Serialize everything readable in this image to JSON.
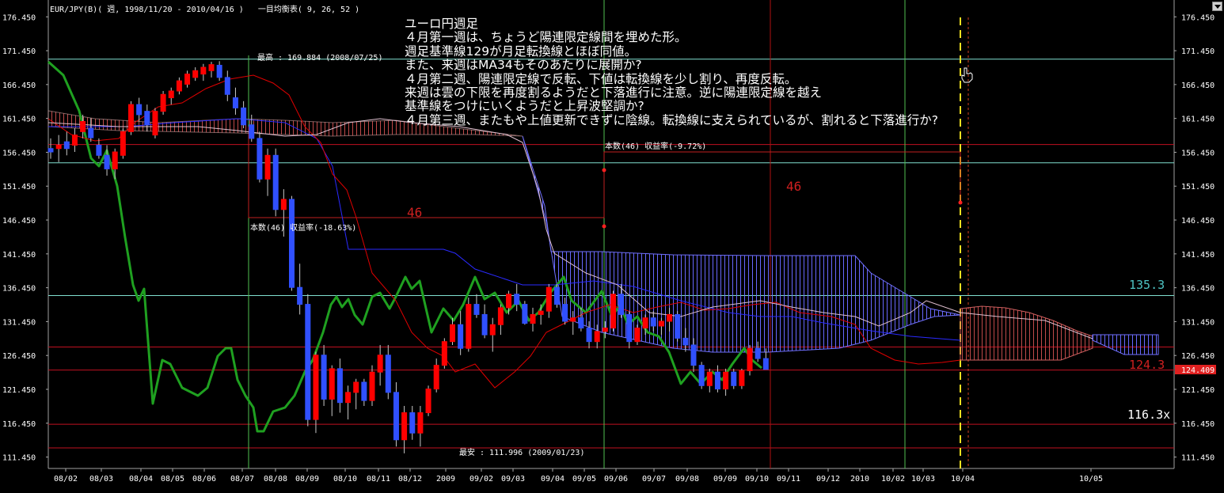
{
  "header": {
    "symbol": "EUR/JPY(B)( 週, 1998/11/20 - 2010/04/16 )",
    "indicator": "一目均衡表( 9, 26, 52 )"
  },
  "notes": [
    "ユーロ円週足",
    "４月第一週は、ちょうど陽連限定線間を埋めた形。",
    "週足基準線129が月足転換線とほぼ同値。",
    "また、来週はMA34もそのあたりに展開か?",
    "４月第二週、陽連限定線で反転、下値は転換線を少し割り、再度反転。",
    "来週は雲の下限を再度割るようだと下落進行に注意。逆に陽連限定線を越え",
    "基準線をつけにいくようだと上昇波堅調か?",
    "４月第三週、またもや上値更新できずに陰線。転換線に支えられているが、割れると下落進行か?"
  ],
  "annotations": {
    "high_label": "最高 : 169.884 (2008/07/25)",
    "low_label": "最安 : 111.996 (2009/01/23)",
    "count_label_1": "本数(46) 収益率(-18.63%)",
    "count_label_2": "本数(46) 収益率(-9.72%)",
    "count_1": "46",
    "count_2": "46",
    "level_135": "135.3",
    "level_124": "124.3",
    "level_116": "116.3x",
    "current_price": "124.409"
  },
  "colors": {
    "background": "#000000",
    "bull": "#ff0000",
    "bear": "#3050ff",
    "green_line": "#1fa020",
    "red_line": "#e00000",
    "blue_line": "#2a2aff",
    "cloud": "#7070ff",
    "cloud_red": "#d04040",
    "hline_red": "#c01020",
    "hline_cyan": "#80e0d0",
    "vline_green": "#40c040",
    "vline_red": "#b01010",
    "current_bg": "#e02020"
  },
  "chart_data": {
    "type": "candlestick",
    "ylim": [
      110.0,
      178.0
    ],
    "y_ticks": [
      "176.450",
      "171.450",
      "166.450",
      "161.450",
      "156.450",
      "151.450",
      "146.450",
      "141.450",
      "136.450",
      "131.450",
      "126.450",
      "121.450",
      "116.450",
      "111.450"
    ],
    "x_ticks": [
      "08/02",
      "08/03",
      "08/04",
      "08/05",
      "08/06",
      "08/07",
      "08/08",
      "08/09",
      "08/10",
      "08/11",
      "08/12",
      "2009",
      "09/02",
      "09/03",
      "09/04",
      "09/05",
      "09/06",
      "09/07",
      "09/08",
      "09/09",
      "09/10",
      "09/11",
      "09/12",
      "2010",
      "10/02",
      "10/03",
      "10/04",
      "10/05"
    ],
    "horizontal_lines": [
      {
        "price": 135.3,
        "label": "135.3"
      },
      {
        "price": 124.3,
        "label": "124.3"
      },
      {
        "price": 116.3,
        "label": "116.3x"
      },
      {
        "price": 169.884,
        "label": "最高 : 169.884 (2008/07/25)"
      },
      {
        "price": 111.996,
        "label": "最安 : 111.996 (2009/01/23)"
      }
    ],
    "current_price": 124.409,
    "high": {
      "value": 169.884,
      "date": "2008/07/25"
    },
    "low": {
      "value": 111.996,
      "date": "2009/01/23"
    },
    "range_stats": [
      {
        "bars": 46,
        "return_pct": -18.63
      },
      {
        "bars": 46,
        "return_pct": -9.72
      }
    ],
    "candles": [
      [
        157,
        158.5,
        155.5,
        156.5
      ],
      [
        157,
        159,
        155,
        157.5
      ],
      [
        158,
        159.5,
        156,
        157
      ],
      [
        157.5,
        160,
        156.5,
        159
      ],
      [
        159.5,
        162,
        158.5,
        161
      ],
      [
        160,
        161.5,
        158,
        158.6
      ],
      [
        157.5,
        158.5,
        155.5,
        156
      ],
      [
        156,
        157.5,
        153,
        154
      ],
      [
        154,
        157,
        152.5,
        156.5
      ],
      [
        156,
        160,
        155.5,
        159.5
      ],
      [
        159.5,
        164,
        159,
        163.5
      ],
      [
        163.5,
        164.5,
        161,
        162
      ],
      [
        162.5,
        163.5,
        159.5,
        160.5
      ],
      [
        159,
        163,
        158.5,
        162.5
      ],
      [
        162.5,
        165.5,
        162,
        165
      ],
      [
        164.5,
        166,
        163.5,
        165.5
      ],
      [
        165.5,
        167.5,
        165,
        167
      ],
      [
        166.5,
        168.5,
        166,
        168
      ],
      [
        167.5,
        169,
        167,
        168.5
      ],
      [
        168,
        169.5,
        167,
        169
      ],
      [
        168.5,
        169.8,
        167.5,
        169.4
      ],
      [
        169.3,
        169.9,
        167,
        167.5
      ],
      [
        167.5,
        168.5,
        164,
        165
      ],
      [
        164.5,
        166,
        162,
        163
      ],
      [
        163,
        164,
        160,
        160.5
      ],
      [
        160.5,
        162,
        158,
        158.5
      ],
      [
        158.5,
        159.5,
        152,
        152.5
      ],
      [
        152.5,
        157,
        150,
        156
      ],
      [
        156,
        157,
        147,
        148
      ],
      [
        148,
        151,
        144,
        149.5
      ],
      [
        149.5,
        150,
        136,
        136.5
      ],
      [
        136.5,
        140,
        132.5,
        134
      ],
      [
        134,
        135.5,
        116,
        117
      ],
      [
        117,
        127,
        115,
        126.5
      ],
      [
        126.5,
        128,
        119,
        120
      ],
      [
        120,
        125,
        117.5,
        124.5
      ],
      [
        124.5,
        126,
        118,
        119.5
      ],
      [
        119.5,
        122,
        117,
        121
      ],
      [
        121,
        123,
        118.5,
        122.5
      ],
      [
        122.5,
        123,
        119,
        119.8
      ],
      [
        119.8,
        125,
        119,
        124
      ],
      [
        124,
        128,
        122,
        126.5
      ],
      [
        126.5,
        128,
        120,
        121
      ],
      [
        121,
        122.5,
        113,
        114
      ],
      [
        114,
        119,
        112,
        118
      ],
      [
        118,
        119,
        114,
        115
      ],
      [
        115,
        119,
        113,
        118
      ],
      [
        118,
        122,
        117.5,
        121.5
      ],
      [
        121.5,
        126,
        121,
        125
      ],
      [
        125,
        129,
        124.5,
        128.5
      ],
      [
        128.5,
        132,
        128,
        131
      ],
      [
        131,
        133,
        126.5,
        127.5
      ],
      [
        127.5,
        135,
        127,
        134
      ],
      [
        134,
        135.5,
        132,
        132.5
      ],
      [
        132.5,
        134,
        129,
        129.5
      ],
      [
        129.5,
        132,
        127,
        131
      ],
      [
        131,
        134,
        129.5,
        133.5
      ],
      [
        133.5,
        136,
        132.5,
        135.5
      ],
      [
        135.5,
        137,
        133,
        134
      ],
      [
        134,
        134.5,
        131,
        131.2
      ],
      [
        131.2,
        133.5,
        130,
        132.5
      ],
      [
        132.5,
        134,
        131,
        133
      ],
      [
        133,
        137,
        132,
        136.5
      ],
      [
        136.5,
        137,
        133.5,
        134
      ],
      [
        134,
        135,
        131,
        131.5
      ],
      [
        131.5,
        133,
        129.5,
        132
      ],
      [
        132,
        133.5,
        130,
        130.5
      ],
      [
        130.5,
        131.5,
        127.5,
        128.5
      ],
      [
        128.5,
        131,
        127.5,
        130
      ],
      [
        130,
        131.5,
        129,
        130.5
      ],
      [
        130.5,
        136,
        130,
        135.5
      ],
      [
        135.5,
        137,
        132,
        132.5
      ],
      [
        132.5,
        133,
        127.5,
        128.5
      ],
      [
        128.5,
        131,
        128,
        130.5
      ],
      [
        130.5,
        132.5,
        129.5,
        132
      ],
      [
        132,
        133,
        130,
        130.8
      ],
      [
        130.8,
        132,
        129.5,
        131.5
      ],
      [
        131.5,
        133.5,
        130,
        132.5
      ],
      [
        132.5,
        133,
        128.5,
        129
      ],
      [
        129,
        130.5,
        127,
        128
      ],
      [
        128,
        129,
        124,
        125
      ],
      [
        125,
        125.5,
        121.5,
        122
      ],
      [
        122,
        124.5,
        121,
        124
      ],
      [
        124,
        125,
        121,
        121.5
      ],
      [
        121.5,
        124.5,
        120.5,
        124
      ],
      [
        124,
        124.5,
        121.5,
        122
      ],
      [
        122,
        124.5,
        121.5,
        124.2
      ],
      [
        124.2,
        128,
        123.5,
        127.5
      ],
      [
        127.5,
        128.5,
        125.5,
        126
      ],
      [
        126,
        127.5,
        124.5,
        124.4
      ]
    ]
  }
}
